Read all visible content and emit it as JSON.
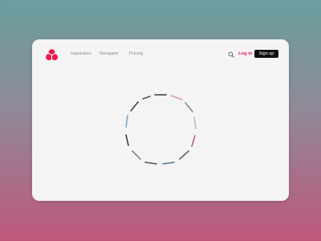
{
  "colors": {
    "accent": "#e8194f",
    "button_bg": "#111111",
    "card_bg": "#f4f4f4",
    "nav_text": "#8c8c8c"
  },
  "nav": {
    "logo_icon": "trefoil-logo-icon",
    "links": [
      "Inspiration",
      "Navigator",
      "Pricing"
    ],
    "search_icon": "search-icon",
    "login_label": "Log in",
    "signup_label": "Sign up"
  },
  "main": {
    "loader_icon": "circular-loading-spinner-icon"
  }
}
